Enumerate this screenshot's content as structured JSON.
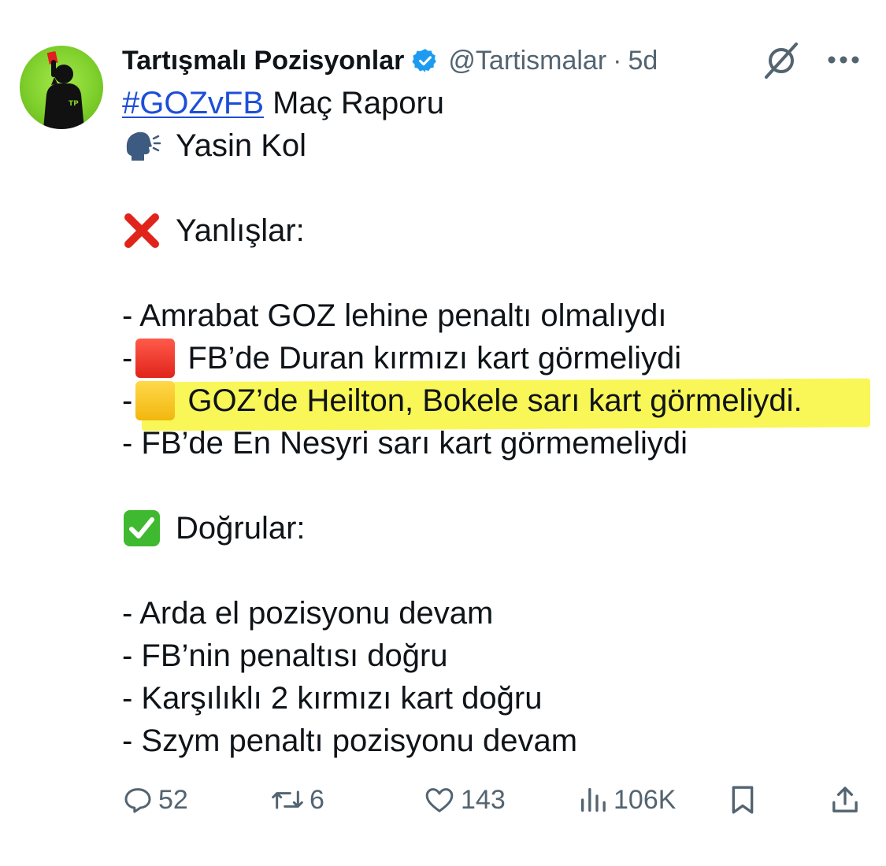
{
  "tweet": {
    "author_name": "Tartışmalı Pozisyonlar",
    "handle": "@Tartismalar",
    "separator": "·",
    "time": "5d",
    "avatar_badge": "TP",
    "hashtag": "#GOZvFB",
    "title_rest": " Maç Raporu",
    "referee_line": "Yasin Kol",
    "wrong_header": "Yanlışlar:",
    "wrong_items": [
      "- Amrabat GOZ lehine penaltı olmalıydı",
      "FB’de Duran kırmızı kart görmeliydi",
      "GOZ’de Heilton, Bokele sarı kart görmeliydi.",
      "- FB’de En Nesyri sarı kart görmemeliydi"
    ],
    "dash": "-",
    "right_header": "Doğrular:",
    "right_items": [
      "- Arda el pozisyonu devam",
      "- FB’nin penaltısı doğru",
      "- Karşılıklı 2 kırmızı kart doğru",
      "- Szym penaltı pozisyonu devam"
    ]
  },
  "actions": {
    "replies": "52",
    "reposts": "6",
    "likes": "143",
    "views": "106K"
  },
  "icons": {
    "verified": "verified-badge-icon",
    "grok": "grok-icon",
    "more": "more-icon",
    "reply": "reply-icon",
    "repost": "repost-icon",
    "like": "like-icon",
    "views": "views-icon",
    "bookmark": "bookmark-icon",
    "share": "share-icon"
  },
  "colors": {
    "text": "#0f1419",
    "muted": "#536471",
    "link": "#1d4ed8",
    "highlight": "#f8f53a",
    "verified": "#1d9bf0"
  }
}
